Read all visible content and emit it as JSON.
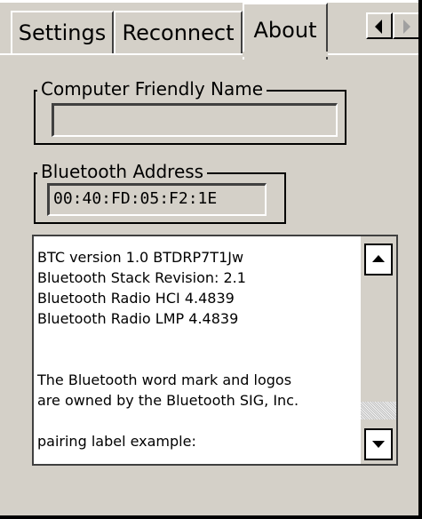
{
  "tabs": [
    {
      "label": "Settings",
      "active": false
    },
    {
      "label": "Reconnect",
      "active": false
    },
    {
      "label": "About",
      "active": true
    }
  ],
  "computer_name": {
    "label": "Computer Friendly Name",
    "value": ""
  },
  "bluetooth_address": {
    "label": "Bluetooth Address",
    "value": "00:40:FD:05:F2:1E"
  },
  "info": {
    "lines": [
      "BTC version 1.0 BTDRP7T1Jw",
      "Bluetooth Stack Revision: 2.1",
      "Bluetooth Radio HCI 4.4839",
      "Bluetooth Radio LMP 4.4839",
      "",
      "",
      "The Bluetooth word mark and logos",
      "are owned by the Bluetooth SIG, Inc.",
      "",
      "pairing label example:"
    ]
  },
  "icons": {
    "tab_scroll_left": "triangle-left-icon",
    "tab_scroll_right": "triangle-right-icon",
    "scroll_up": "triangle-up-icon",
    "scroll_down": "triangle-down-icon"
  },
  "colors": {
    "dialog_background": "#d4d0c8",
    "textbox_background": "#ffffff"
  }
}
